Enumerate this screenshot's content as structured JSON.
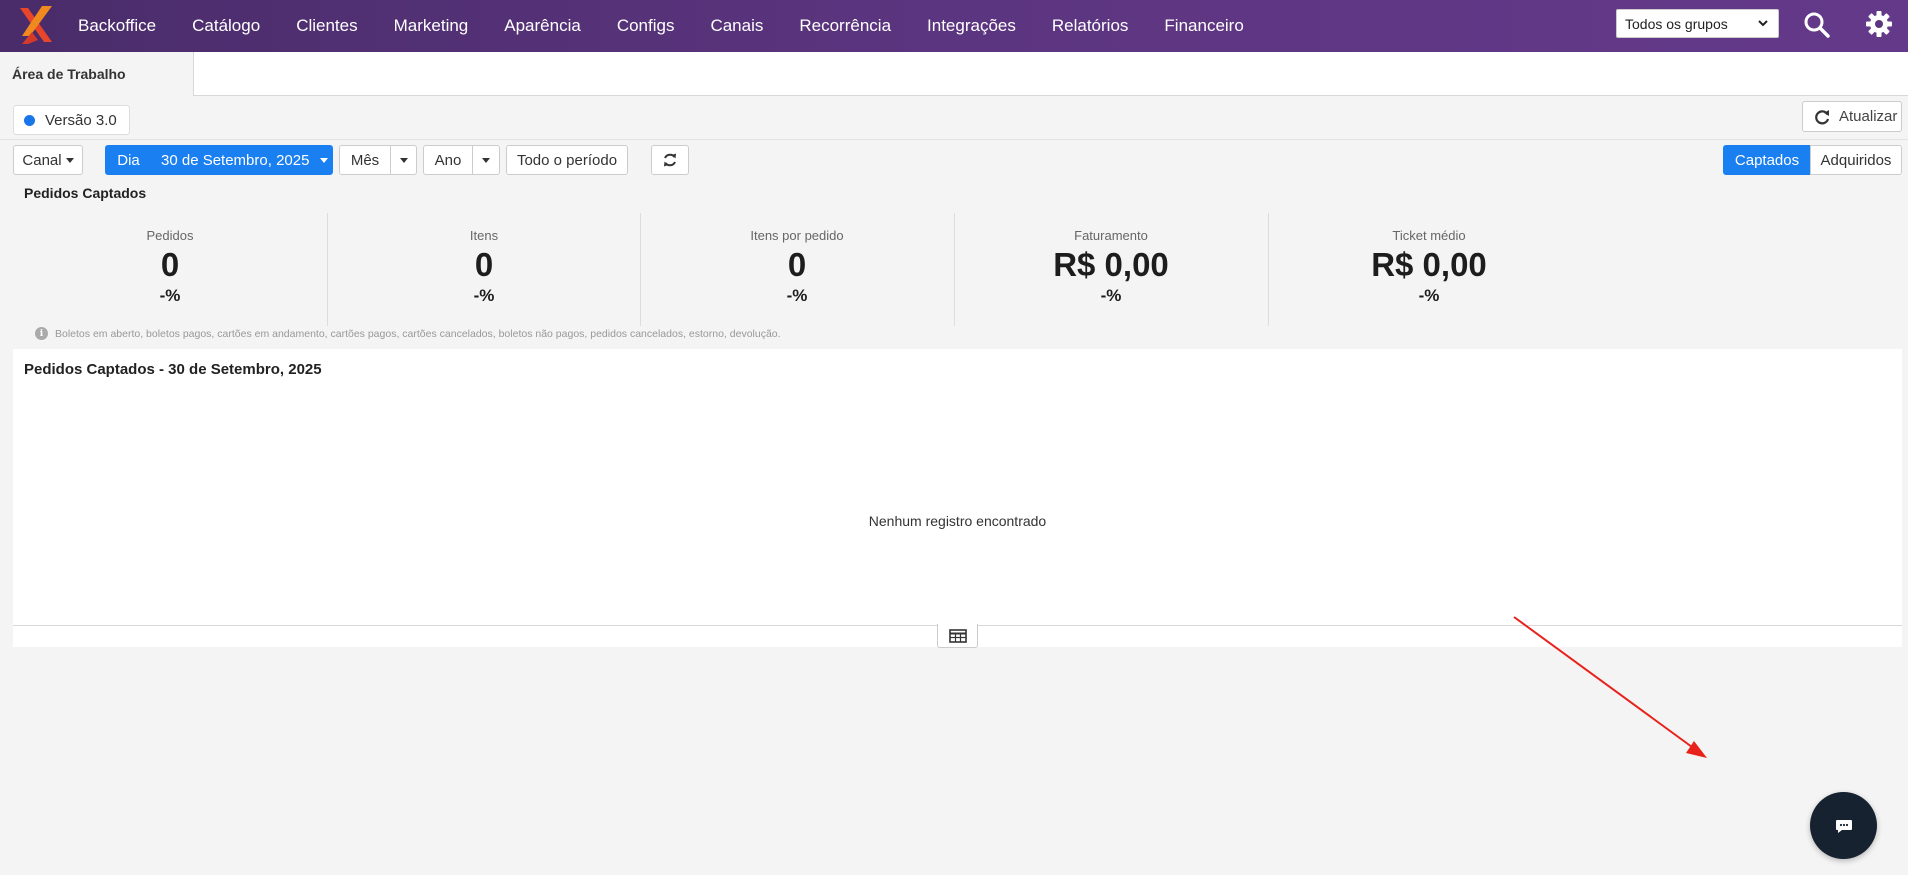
{
  "nav": {
    "items": [
      "Backoffice",
      "Catálogo",
      "Clientes",
      "Marketing",
      "Aparência",
      "Configs",
      "Canais",
      "Recorrência",
      "Integrações",
      "Relatórios",
      "Financeiro"
    ],
    "group_select": "Todos os grupos"
  },
  "workspace_tab": "Área de Trabalho",
  "version_label": "Versão 3.0",
  "refresh_label": "Atualizar",
  "filters": {
    "canal": "Canal",
    "dia": "Dia",
    "date": "30 de Setembro, 2025",
    "mes": "Mês",
    "ano": "Ano",
    "todo": "Todo o período"
  },
  "toggle": {
    "captados": "Captados",
    "adquiridos": "Adquiridos"
  },
  "section_title": "Pedidos Captados",
  "stats": [
    {
      "label": "Pedidos",
      "value": "0",
      "pct": "-%"
    },
    {
      "label": "Itens",
      "value": "0",
      "pct": "-%"
    },
    {
      "label": "Itens por pedido",
      "value": "0",
      "pct": "-%"
    },
    {
      "label": "Faturamento",
      "value": "R$ 0,00",
      "pct": "-%"
    },
    {
      "label": "Ticket médio",
      "value": "R$ 0,00",
      "pct": "-%"
    }
  ],
  "info_note": "Boletos em aberto, boletos pagos, cartões em andamento, cartões pagos, cartões cancelados, boletos não pagos, pedidos cancelados, estorno, devolução.",
  "panel": {
    "title": "Pedidos Captados - 30 de Setembro, 2025",
    "empty": "Nenhum registro encontrado"
  },
  "colors": {
    "nav_start": "#4a2c6a",
    "nav_end": "#64398a",
    "primary": "#1a7ff0",
    "chat": "#172231",
    "arrow": "#e8221a"
  }
}
